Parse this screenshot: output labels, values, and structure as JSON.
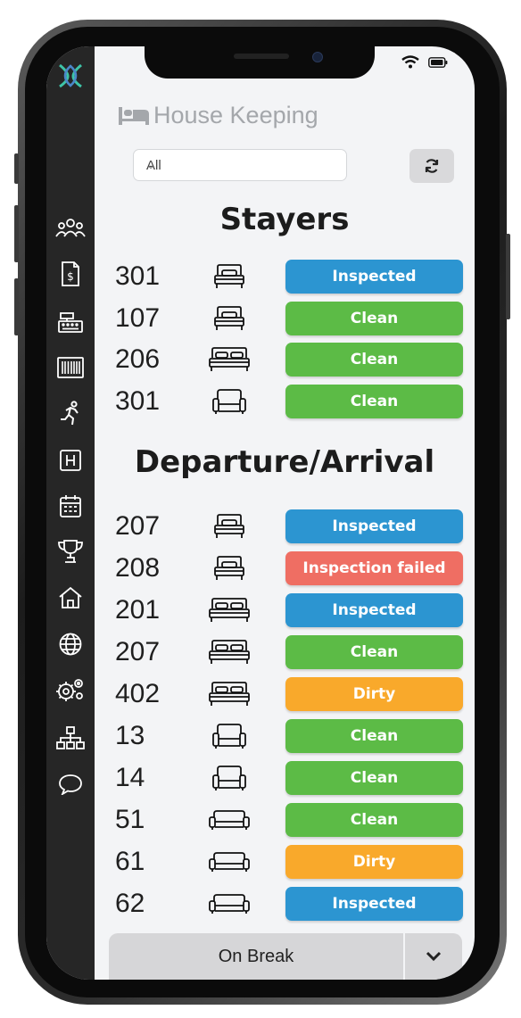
{
  "header": {
    "title": "House Keeping"
  },
  "filter": {
    "selected": "All"
  },
  "sections": [
    {
      "title": "Stayers",
      "rows": [
        {
          "room": "301",
          "room_icon": "single-bed-icon",
          "status": "Inspected",
          "color": "#2c95d1"
        },
        {
          "room": "107",
          "room_icon": "single-bed-icon",
          "status": "Clean",
          "color": "#5cbb46"
        },
        {
          "room": "206",
          "room_icon": "double-bed-icon",
          "status": "Clean",
          "color": "#5cbb46"
        },
        {
          "room": "301",
          "room_icon": "armchair-icon",
          "status": "Clean",
          "color": "#5cbb46"
        }
      ]
    },
    {
      "title": "Departure/Arrival",
      "rows": [
        {
          "room": "207",
          "room_icon": "single-bed-icon",
          "status": "Inspected",
          "color": "#2c95d1"
        },
        {
          "room": "208",
          "room_icon": "single-bed-icon",
          "status": "Inspection failed",
          "color": "#ef6e63"
        },
        {
          "room": "201",
          "room_icon": "double-bed-icon",
          "status": "Inspected",
          "color": "#2c95d1"
        },
        {
          "room": "207",
          "room_icon": "double-bed-icon",
          "status": "Clean",
          "color": "#5cbb46"
        },
        {
          "room": "402",
          "room_icon": "double-bed-icon",
          "status": "Dirty",
          "color": "#f9a92b"
        },
        {
          "room": "13",
          "room_icon": "armchair-icon",
          "status": "Clean",
          "color": "#5cbb46"
        },
        {
          "room": "14",
          "room_icon": "armchair-icon",
          "status": "Clean",
          "color": "#5cbb46"
        },
        {
          "room": "51",
          "room_icon": "sofa-icon",
          "status": "Clean",
          "color": "#5cbb46"
        },
        {
          "room": "61",
          "room_icon": "sofa-icon",
          "status": "Dirty",
          "color": "#f9a92b"
        },
        {
          "room": "62",
          "room_icon": "sofa-icon",
          "status": "Inspected",
          "color": "#2c95d1"
        }
      ]
    }
  ],
  "footer": {
    "break_label": "On Break"
  },
  "sidebar": {
    "items": [
      "users-icon",
      "invoice-icon",
      "cash-register-icon",
      "barcode-icon",
      "running-man-icon",
      "hotel-h-icon",
      "calendar-icon",
      "trophy-icon",
      "home-icon",
      "globe-icon",
      "settings-icon",
      "sitemap-icon",
      "chat-icon"
    ]
  },
  "colors": {
    "inspected": "#2c95d1",
    "clean": "#5cbb46",
    "dirty": "#f9a92b",
    "failed": "#ef6e63",
    "sidebar": "#262626"
  }
}
